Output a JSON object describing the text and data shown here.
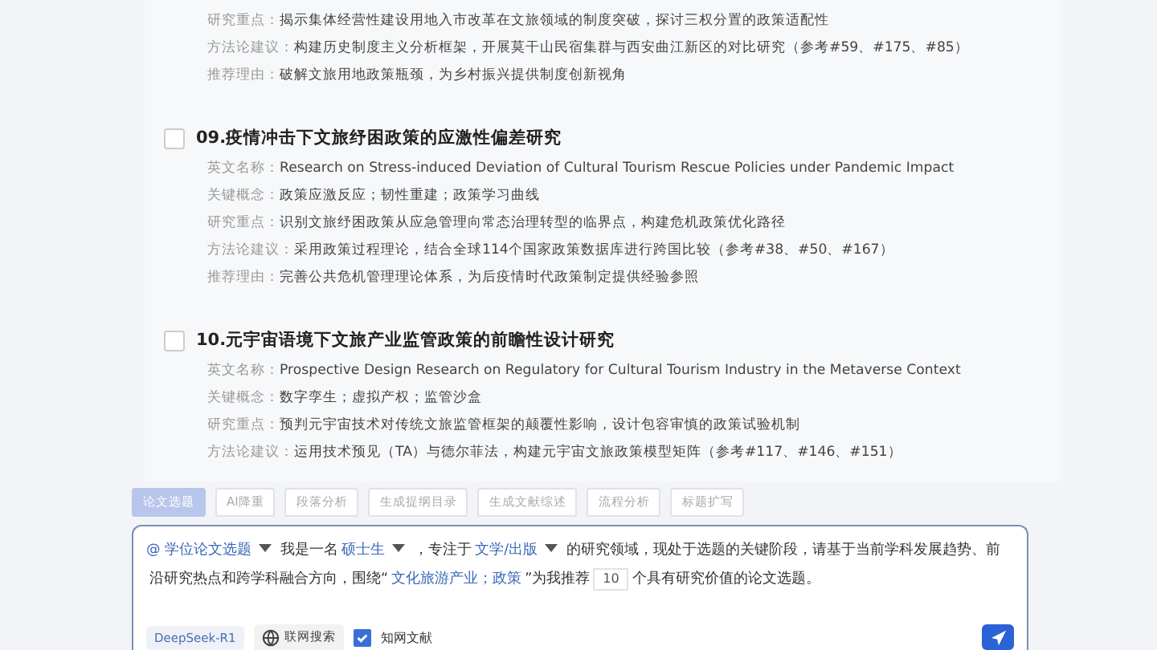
{
  "topics": [
    {
      "fields": [
        {
          "label": "研究重点：",
          "value": "揭示集体经营性建设用地入市改革在文旅领域的制度突破，探讨三权分置的政策适配性"
        },
        {
          "label": "方法论建议：",
          "value": "构建历史制度主义分析框架，开展莫干山民宿集群与西安曲江新区的对比研究（参考#59、#175、#85）"
        },
        {
          "label": "推荐理由：",
          "value": "破解文旅用地政策瓶颈，为乡村振兴提供制度创新视角"
        }
      ]
    },
    {
      "title": "09.疫情冲击下文旅纾困政策的应激性偏差研究",
      "checked": false,
      "fields": [
        {
          "label": "英文名称：",
          "value": "Research on Stress-induced Deviation of Cultural Tourism Rescue Policies under Pandemic Impact"
        },
        {
          "label": "关键概念：",
          "value": "政策应激反应；韧性重建；政策学习曲线"
        },
        {
          "label": "研究重点：",
          "value": "识别文旅纾困政策从应急管理向常态治理转型的临界点，构建危机政策优化路径"
        },
        {
          "label": "方法论建议：",
          "value": "采用政策过程理论，结合全球114个国家政策数据库进行跨国比较（参考#38、#50、#167）"
        },
        {
          "label": "推荐理由：",
          "value": "完善公共危机管理理论体系，为后疫情时代政策制定提供经验参照"
        }
      ]
    },
    {
      "title": "10.元宇宙语境下文旅产业监管政策的前瞻性设计研究",
      "checked": false,
      "fields": [
        {
          "label": "英文名称：",
          "value": "Prospective Design Research on Regulatory for Cultural Tourism Industry in the Metaverse Context"
        },
        {
          "label": "关键概念：",
          "value": "数字孪生；虚拟产权；监管沙盒"
        },
        {
          "label": "研究重点：",
          "value": "预判元宇宙技术对传统文旅监管框架的颠覆性影响，设计包容审慎的政策试验机制"
        },
        {
          "label": "方法论建议：",
          "value": "运用技术预见（TA）与德尔菲法，构建元宇宙文旅政策模型矩阵（参考#117、#146、#151）"
        }
      ]
    }
  ],
  "tools": [
    {
      "label": "论文选题",
      "selected": true
    },
    {
      "label": "AI降重",
      "selected": false
    },
    {
      "label": "段落分析",
      "selected": false
    },
    {
      "label": "生成提纲目录",
      "selected": false
    },
    {
      "label": "生成文献综述",
      "selected": false
    },
    {
      "label": "流程分析",
      "selected": false
    },
    {
      "label": "标题扩写",
      "selected": false
    }
  ],
  "prompt": [
    {
      "kind": "dropdown",
      "text": "@ 学位论文选题"
    },
    {
      "kind": "text",
      "text": "我是一名"
    },
    {
      "kind": "dropdown",
      "text": "硕士生"
    },
    {
      "kind": "text",
      "text": "，专注于"
    },
    {
      "kind": "dropdown",
      "text": "文学/出版"
    },
    {
      "kind": "text",
      "text": "的研究领域，现处于选题的关键阶段，请基于当前学科发展趋势、前"
    },
    {
      "kind": "text",
      "text": "沿研究热点和跨学科融合方向，围绕“"
    },
    {
      "kind": "tag",
      "text": "文化旅游产业；政策"
    },
    {
      "kind": "text",
      "text": "”为我推荐"
    },
    {
      "kind": "number",
      "text": "10"
    },
    {
      "kind": "text",
      "text": "个具有研究价值的论文选题。"
    }
  ],
  "model": "DeepSeek-R1",
  "web_search": "联网搜索",
  "cnki": {
    "label": "知网文献",
    "checked": true
  }
}
